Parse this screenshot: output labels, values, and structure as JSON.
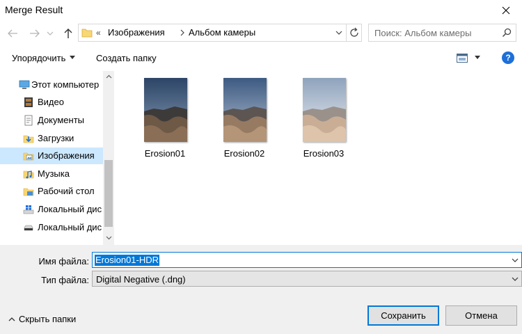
{
  "window": {
    "title": "Merge Result"
  },
  "address": {
    "overflow": "«",
    "crumbs": [
      "Изображения",
      "Альбом камеры"
    ]
  },
  "search": {
    "placeholder": "Поиск: Альбом камеры"
  },
  "toolbar": {
    "organize_label": "Упорядочить",
    "new_folder_label": "Создать папку",
    "help_label": "?"
  },
  "nav": {
    "items": [
      {
        "label": "Этот компьютер",
        "icon": "computer-icon"
      },
      {
        "label": "Видео",
        "icon": "video-folder-icon"
      },
      {
        "label": "Документы",
        "icon": "documents-folder-icon"
      },
      {
        "label": "Загрузки",
        "icon": "downloads-folder-icon"
      },
      {
        "label": "Изображения",
        "icon": "pictures-folder-icon",
        "selected": true
      },
      {
        "label": "Музыка",
        "icon": "music-folder-icon"
      },
      {
        "label": "Рабочий стол",
        "icon": "desktop-folder-icon"
      },
      {
        "label": "Локальный дис",
        "icon": "windows-drive-icon"
      },
      {
        "label": "Локальный дис",
        "icon": "drive-icon"
      }
    ]
  },
  "files": [
    {
      "name": "Erosion01"
    },
    {
      "name": "Erosion02"
    },
    {
      "name": "Erosion03"
    }
  ],
  "form": {
    "filename_label": "Имя файла:",
    "filename_value": "Erosion01-HDR",
    "filetype_label": "Тип файла:",
    "filetype_value": "Digital Negative (.dng)"
  },
  "footer": {
    "hide_folders_label": "Скрыть папки",
    "save_label": "Сохранить",
    "cancel_label": "Отмена"
  },
  "colors": {
    "accent": "#0078d7",
    "selection": "#cce8ff",
    "help": "#1e6fd9",
    "panel": "#f0f0f0"
  }
}
